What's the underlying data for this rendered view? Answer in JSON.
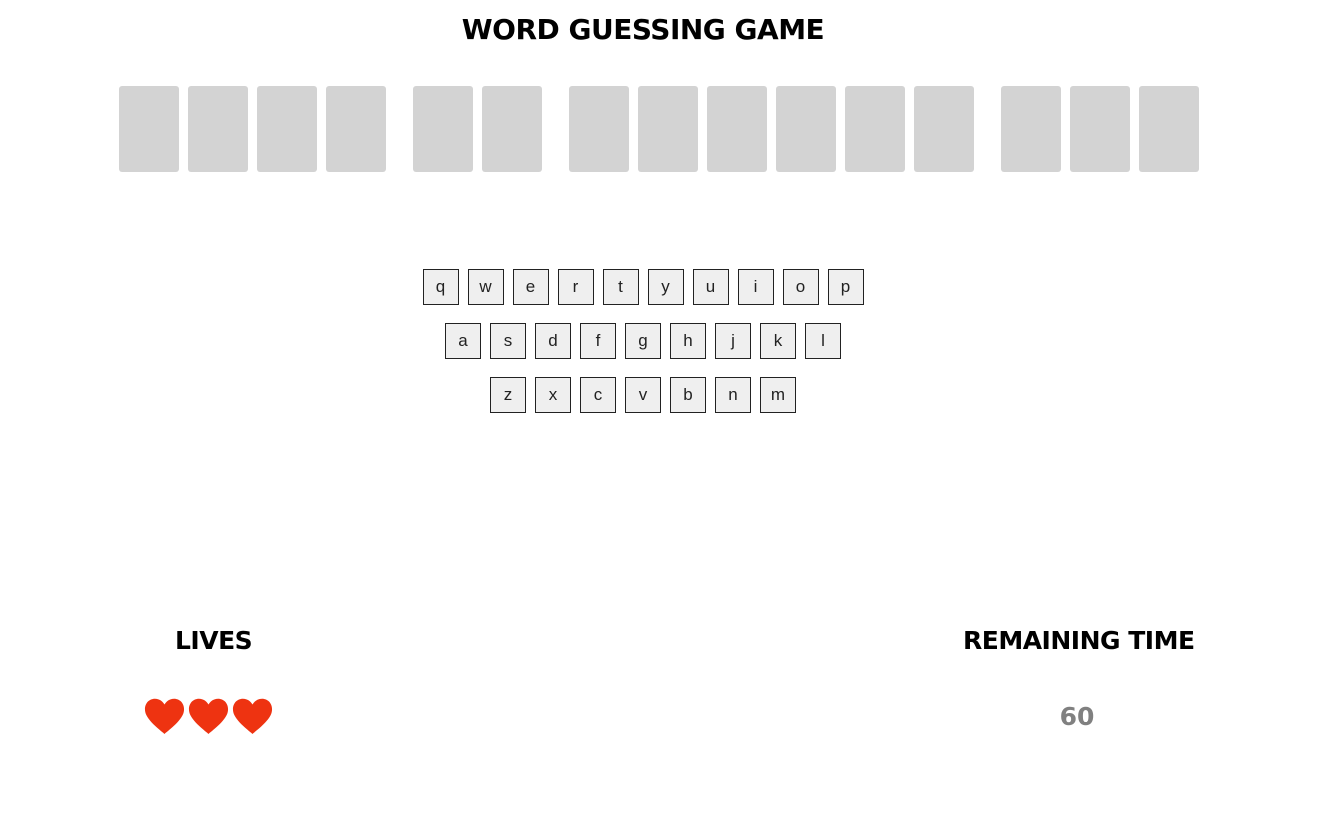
{
  "game": {
    "title": "WORD GUESSING GAME"
  },
  "word": {
    "groups": [
      4,
      2,
      6,
      3
    ],
    "revealed_letters": [
      "",
      "",
      "",
      "",
      "",
      "",
      "",
      "",
      "",
      "",
      "",
      "",
      "",
      "",
      ""
    ]
  },
  "keyboard": {
    "rows": [
      [
        "q",
        "w",
        "e",
        "r",
        "t",
        "y",
        "u",
        "i",
        "o",
        "p"
      ],
      [
        "a",
        "s",
        "d",
        "f",
        "g",
        "h",
        "j",
        "k",
        "l"
      ],
      [
        "z",
        "x",
        "c",
        "v",
        "b",
        "n",
        "m"
      ]
    ]
  },
  "lives": {
    "heading": "LIVES",
    "remaining": 3,
    "icon": "heart-icon",
    "color": "#ee3311"
  },
  "timer": {
    "heading": "REMAINING TIME",
    "value": "60",
    "color": "#808080"
  },
  "colors": {
    "slot": "#d3d3d3",
    "key_background": "#efefef",
    "key_border": "#222222"
  }
}
